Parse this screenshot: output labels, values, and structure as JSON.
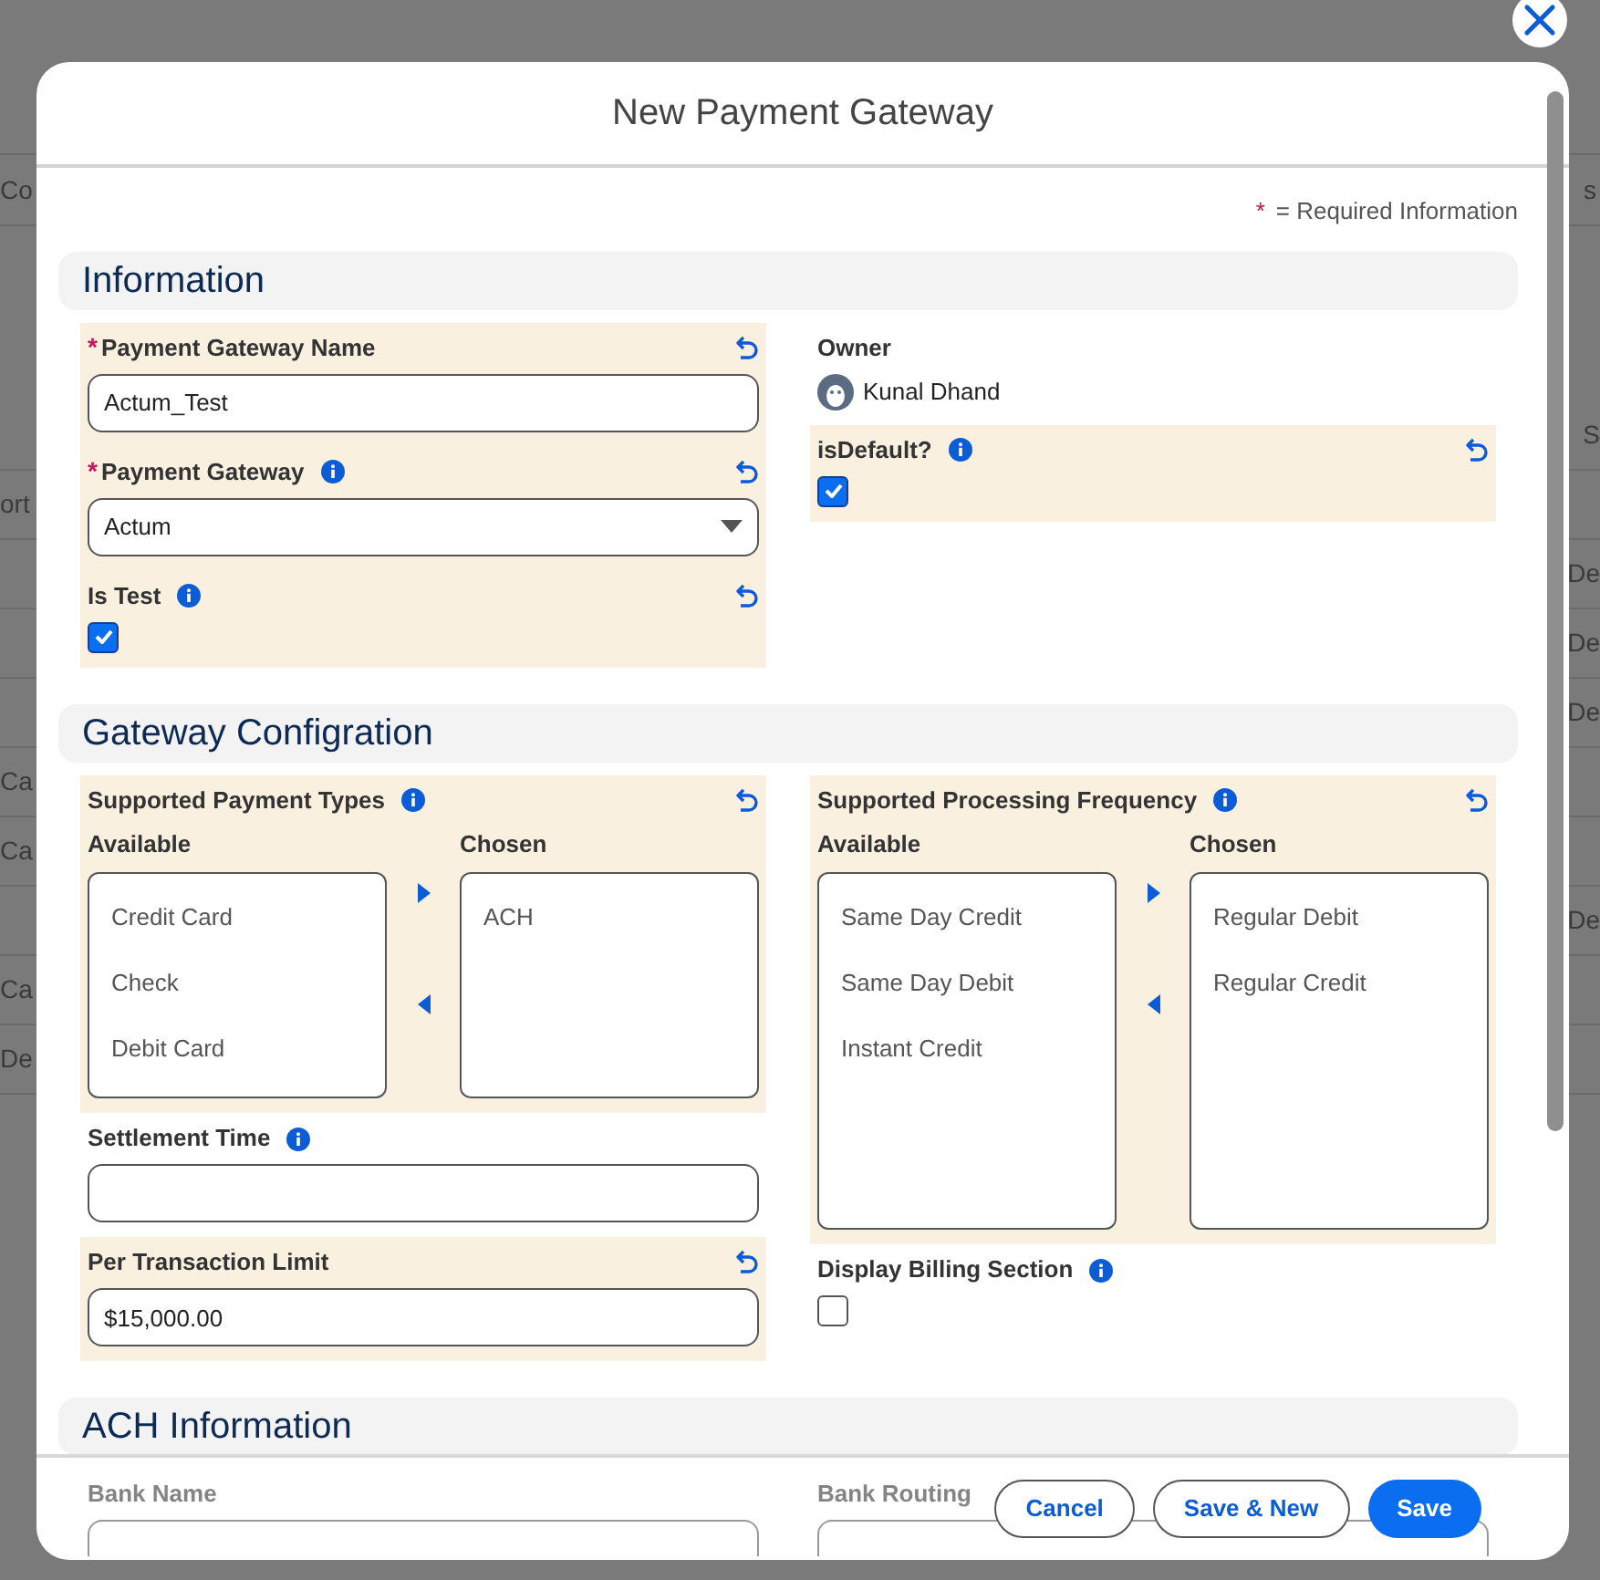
{
  "background": {
    "header": {
      "left": "Co",
      "right": "s"
    },
    "rows": [
      {
        "right": "S"
      },
      {
        "left": "ort"
      },
      {
        "right": "De"
      },
      {
        "right": "De"
      },
      {
        "right": "De"
      },
      {
        "left": "Ca"
      },
      {
        "left": "Ca"
      },
      {
        "right": "De"
      },
      {
        "left": "Ca"
      },
      {
        "left": "De"
      }
    ]
  },
  "dialog": {
    "title": "New Payment Gateway",
    "required_note": {
      "mark": "*",
      "text": "= Required Information"
    },
    "sections": [
      {
        "title": "Information",
        "columns": [
          [
            {
              "kind": "text",
              "label": "Payment Gateway Name",
              "required": true,
              "info": false,
              "modified": true,
              "value": "Actum_Test"
            },
            {
              "kind": "select",
              "label": "Payment Gateway",
              "required": true,
              "info": true,
              "modified": true,
              "value": "Actum"
            },
            {
              "kind": "checkbox",
              "label": "Is Test",
              "required": false,
              "info": true,
              "modified": true,
              "checked": true
            }
          ],
          [
            {
              "kind": "owner",
              "label": "Owner",
              "required": false,
              "info": false,
              "modified": false,
              "value": "Kunal Dhand"
            },
            {
              "kind": "checkbox",
              "label": "isDefault?",
              "required": false,
              "info": true,
              "modified": true,
              "checked": true
            }
          ]
        ]
      },
      {
        "title": "Gateway Configration",
        "columns": [
          [
            {
              "kind": "dual-listbox",
              "label": "Supported Payment Types",
              "required": false,
              "info": true,
              "modified": true,
              "available_label": "Available",
              "chosen_label": "Chosen",
              "available": [
                "Credit Card",
                "Check",
                "Debit Card"
              ],
              "chosen": [
                "ACH"
              ]
            },
            {
              "kind": "text",
              "label": "Settlement Time",
              "required": false,
              "info": true,
              "modified": false
            },
            {
              "kind": "text",
              "label": "Per Transaction Limit",
              "required": false,
              "info": false,
              "modified": true,
              "value": "$15,000.00"
            }
          ],
          [
            {
              "kind": "dual-listbox",
              "label": "Supported Processing Frequency",
              "required": false,
              "info": true,
              "modified": true,
              "available_label": "Available",
              "chosen_label": "Chosen",
              "available": [
                "Same Day Credit",
                "Same Day Debit",
                "Instant Credit"
              ],
              "chosen": [
                "Regular Debit",
                "Regular Credit"
              ]
            },
            {
              "kind": "checkbox",
              "label": "Display Billing Section",
              "required": false,
              "info": true,
              "modified": false,
              "checked": false
            }
          ]
        ]
      },
      {
        "title": "ACH Information",
        "columns": [
          [
            {
              "kind": "text",
              "label": "Bank Name",
              "required": false,
              "info": false,
              "modified": false
            }
          ],
          [
            {
              "kind": "text",
              "label": "Bank Routing",
              "required": false,
              "info": false,
              "modified": false
            }
          ]
        ]
      }
    ],
    "buttons": [
      {
        "label": "Cancel",
        "kind": "secondary"
      },
      {
        "label": "Save & New",
        "kind": "secondary"
      },
      {
        "label": "Save",
        "kind": "primary"
      }
    ]
  }
}
